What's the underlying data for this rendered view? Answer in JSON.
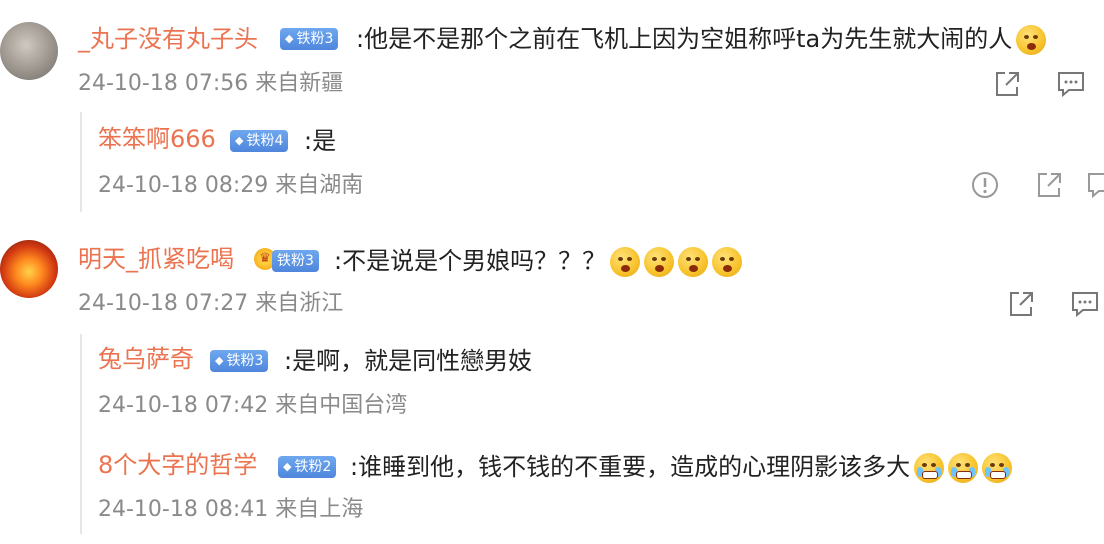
{
  "comments": [
    {
      "username": "_丸子没有丸子头",
      "badge": "铁粉3",
      "text": ":他是不是那个之前在飞机上因为空姐称呼ta为先生就大闹的人",
      "meta": "24-10-18 07:56 来自新疆"
    },
    {
      "username": "笨笨啊666",
      "badge": "铁粉4",
      "text": ":是",
      "meta": "24-10-18 08:29 来自湖南"
    },
    {
      "username": "明天_抓紧吃喝",
      "badge": "铁粉3",
      "text": ":不是说是个男娘吗？？？",
      "meta": "24-10-18 07:27 来自浙江"
    },
    {
      "username": "兔乌萨奇",
      "badge": "铁粉3",
      "text": ":是啊，就是同性戀男妓",
      "meta": "24-10-18 07:42 来自中国台湾"
    },
    {
      "username": "8个大字的哲学",
      "badge": "铁粉2",
      "text": ":谁睡到他，钱不钱的不重要，造成的心理阴影该多大",
      "meta": "24-10-18 08:41 来自上海"
    }
  ],
  "icons": {
    "share": "share-icon",
    "comment": "comment-icon",
    "report": "report-icon",
    "diamond": "diamond-icon",
    "emoji": "emoji-icon"
  },
  "colors": {
    "username": "#eb7350",
    "badge": "#5a90e2",
    "meta": "#8a8a8a",
    "text": "#222222"
  }
}
